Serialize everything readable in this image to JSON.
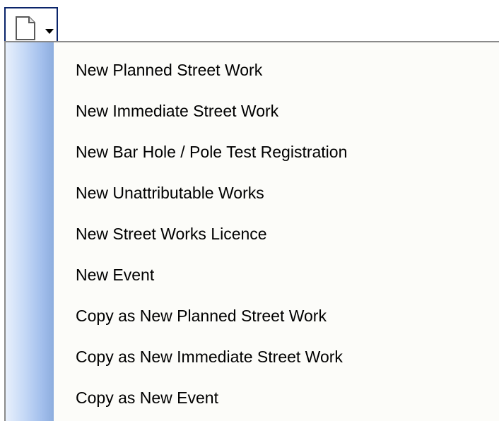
{
  "toolbar": {
    "new_button_icon": "new-document-icon",
    "dropdown_icon": "chevron-down-icon"
  },
  "menu": {
    "items": [
      {
        "label": "New Planned Street Work"
      },
      {
        "label": "New Immediate Street Work"
      },
      {
        "label": "New Bar Hole / Pole Test Registration"
      },
      {
        "label": "New Unattributable Works"
      },
      {
        "label": "New Street Works Licence"
      },
      {
        "label": "New Event"
      },
      {
        "label": "Copy as New Planned Street Work"
      },
      {
        "label": "Copy as New Immediate Street Work"
      },
      {
        "label": "Copy as New Event"
      }
    ]
  },
  "colors": {
    "button_border": "#0a246a",
    "menu_border": "#8a8a8a",
    "menu_background": "#fcfcf9",
    "gutter_light": "#e8f0fc",
    "gutter_dark": "#8dadde"
  }
}
